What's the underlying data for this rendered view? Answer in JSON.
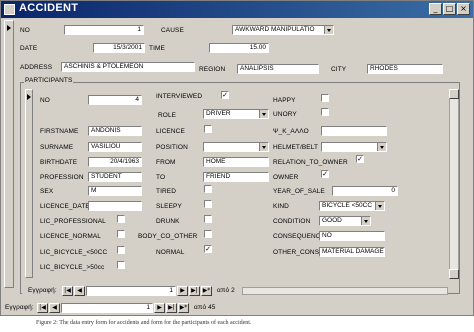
{
  "window": {
    "title": "ACCIDENT"
  },
  "accident": {
    "no_label": "NO",
    "no_value": "1",
    "cause_label": "CAUSE",
    "cause_value": "AWKWARD MANIPULATIO",
    "date_label": "DATE",
    "date_value": "15/3/2001",
    "time_label": "TIME",
    "time_value": "15.00",
    "address_label": "ADDRESS",
    "address_value": "ASCHINIS & PTOLEMEON",
    "region_label": "REGION",
    "region_value": "ANALIPSIS",
    "city_label": "CITY",
    "city_value": "RHODES"
  },
  "participants": {
    "group_label": "PARTICIPANTS",
    "no_label": "NO",
    "no_value": "4",
    "interviewed_label": "INTERVIEWED",
    "interviewed_checked": "✓",
    "happy_label": "HAPPY",
    "role_label": "ROLE",
    "role_value": "DRIVER",
    "unory_label": "UNORY",
    "firstname_label": "FIRSTNAME",
    "firstname_value": "ANDONIS",
    "licence_label": "LICENCE",
    "psi_label": "Ψ_Κ_ΑΛΛΟ",
    "surname_label": "SURNAME",
    "surname_value": "VASILIOU",
    "position_label": "POSITION",
    "helmet_label": "HELMET/BELT",
    "birthdate_label": "BIRTHDATE",
    "birthdate_value": "20/4/1963",
    "from_label": "FROM",
    "from_value": "HOME",
    "relation_label": "RELATION_TO_OWNER",
    "relation_checked": "✓",
    "profession_label": "PROFESSION",
    "profession_value": "STUDENT",
    "to_label": "TO",
    "to_value": "FRIEND",
    "owner_label": "OWNER",
    "owner_checked": "✓",
    "sex_label": "SEX",
    "sex_value": "M",
    "tired_label": "TIRED",
    "year_label": "YEAR_OF_SALE",
    "year_value": "0",
    "licence_date_label": "LICENCE_DATE",
    "sleepy_label": "SLEEPY",
    "kind_label": "KIND",
    "kind_value": "BICYCLE <50CC",
    "lic_prof_label": "LIC_PROFESSIONAL",
    "drunk_label": "DRUNK",
    "condition_label": "CONDITION",
    "condition_value": "GOOD",
    "licence_normal_label": "LICENCE_NORMAL",
    "body_label": "BODY_CO_OTHER",
    "consequence_label": "CONSEQUENC",
    "consequence_value": "NO",
    "lic_bic_label": "LIC_BICYCLE_<50CC",
    "normal_label": "NORMAL",
    "normal_checked": "✓",
    "other_cons_label": "OTHER_CONS",
    "other_cons_value": "MATERIAL DAMAGE",
    "lic_bic2_label": "LIC_BICYCLE_>50cc"
  },
  "subnav": {
    "record_label": "Εγγραφή:",
    "current": "1",
    "of_label": "από 2"
  },
  "mainnav": {
    "record_label": "Εγγραφή:",
    "current": "1",
    "of_label": "από 45"
  },
  "caption": "Figure 2: The data entry form for accidents and form for the participants of each accident."
}
